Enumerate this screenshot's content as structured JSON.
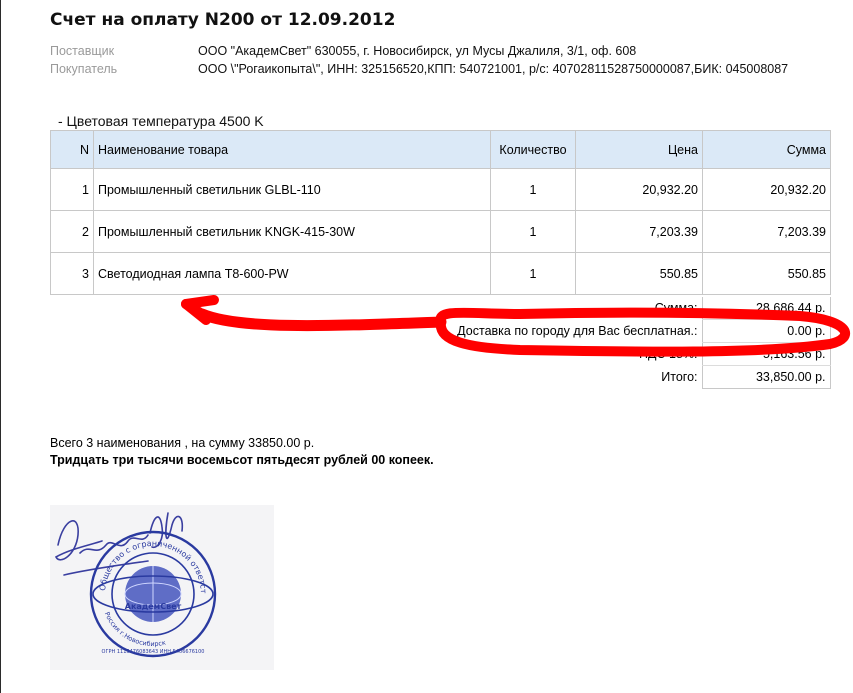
{
  "document": {
    "title": "Счет на оплату N200 от 12.09.2012",
    "supplier_label": "Поставщик",
    "supplier_value": "ООО \"АкадемСвет\" 630055, г. Новосибирск, ул Мусы Джалиля, 3/1, оф. 608",
    "buyer_label": "Покупатель",
    "buyer_value": "ООО \\\"Рогаикопыта\\\", ИНН: 325156520,КПП: 540721001, р/с: 40702811528750000087,БИК: 045008087",
    "section_heading": "- Цветовая температура 4500 K"
  },
  "table": {
    "headers": {
      "n": "N",
      "name": "Наименование товара",
      "qty": "Количество",
      "price": "Цена",
      "sum": "Сумма"
    },
    "rows": [
      {
        "n": "1",
        "name": "Промышленный светильник GLBL-110",
        "qty": "1",
        "price": "20,932.20",
        "sum": "20,932.20"
      },
      {
        "n": "2",
        "name": "Промышленный светильник KNGK-415-30W",
        "qty": "1",
        "price": "7,203.39",
        "sum": "7,203.39"
      },
      {
        "n": "3",
        "name": "Светодиодная лампа Т8-600-PW",
        "qty": "1",
        "price": "550.85",
        "sum": "550.85"
      }
    ]
  },
  "totals": {
    "sum_label": "Сумма:",
    "sum_value": "28,686.44 р.",
    "delivery_label": "Доставка по городу для Вас бесплатная.:",
    "delivery_value": "0.00 р.",
    "vat_label": "НДС 18%:",
    "vat_value": "5,163.56 р.",
    "total_label": "Итого:",
    "total_value": "33,850.00 р."
  },
  "summary": {
    "count_line": "Всего 3 наименования , на сумму 33850.00 р.",
    "words_line": "Тридцать три тысячи восемьсот пятьдесят рублей 00 копеек."
  },
  "stamp": {
    "ring_text": "Общество с ограниченной ответственностью",
    "company": "АкадемСвет",
    "city": "Россия г.Новосибирск",
    "ogrn": "ОГРН 1115476083643 ИНН 5406676100"
  },
  "colors": {
    "header_bg": "#dbe9f7",
    "label_gray": "#9a9a9a",
    "annotation_red": "#ff0000",
    "stamp_blue": "#2a3aa0"
  }
}
